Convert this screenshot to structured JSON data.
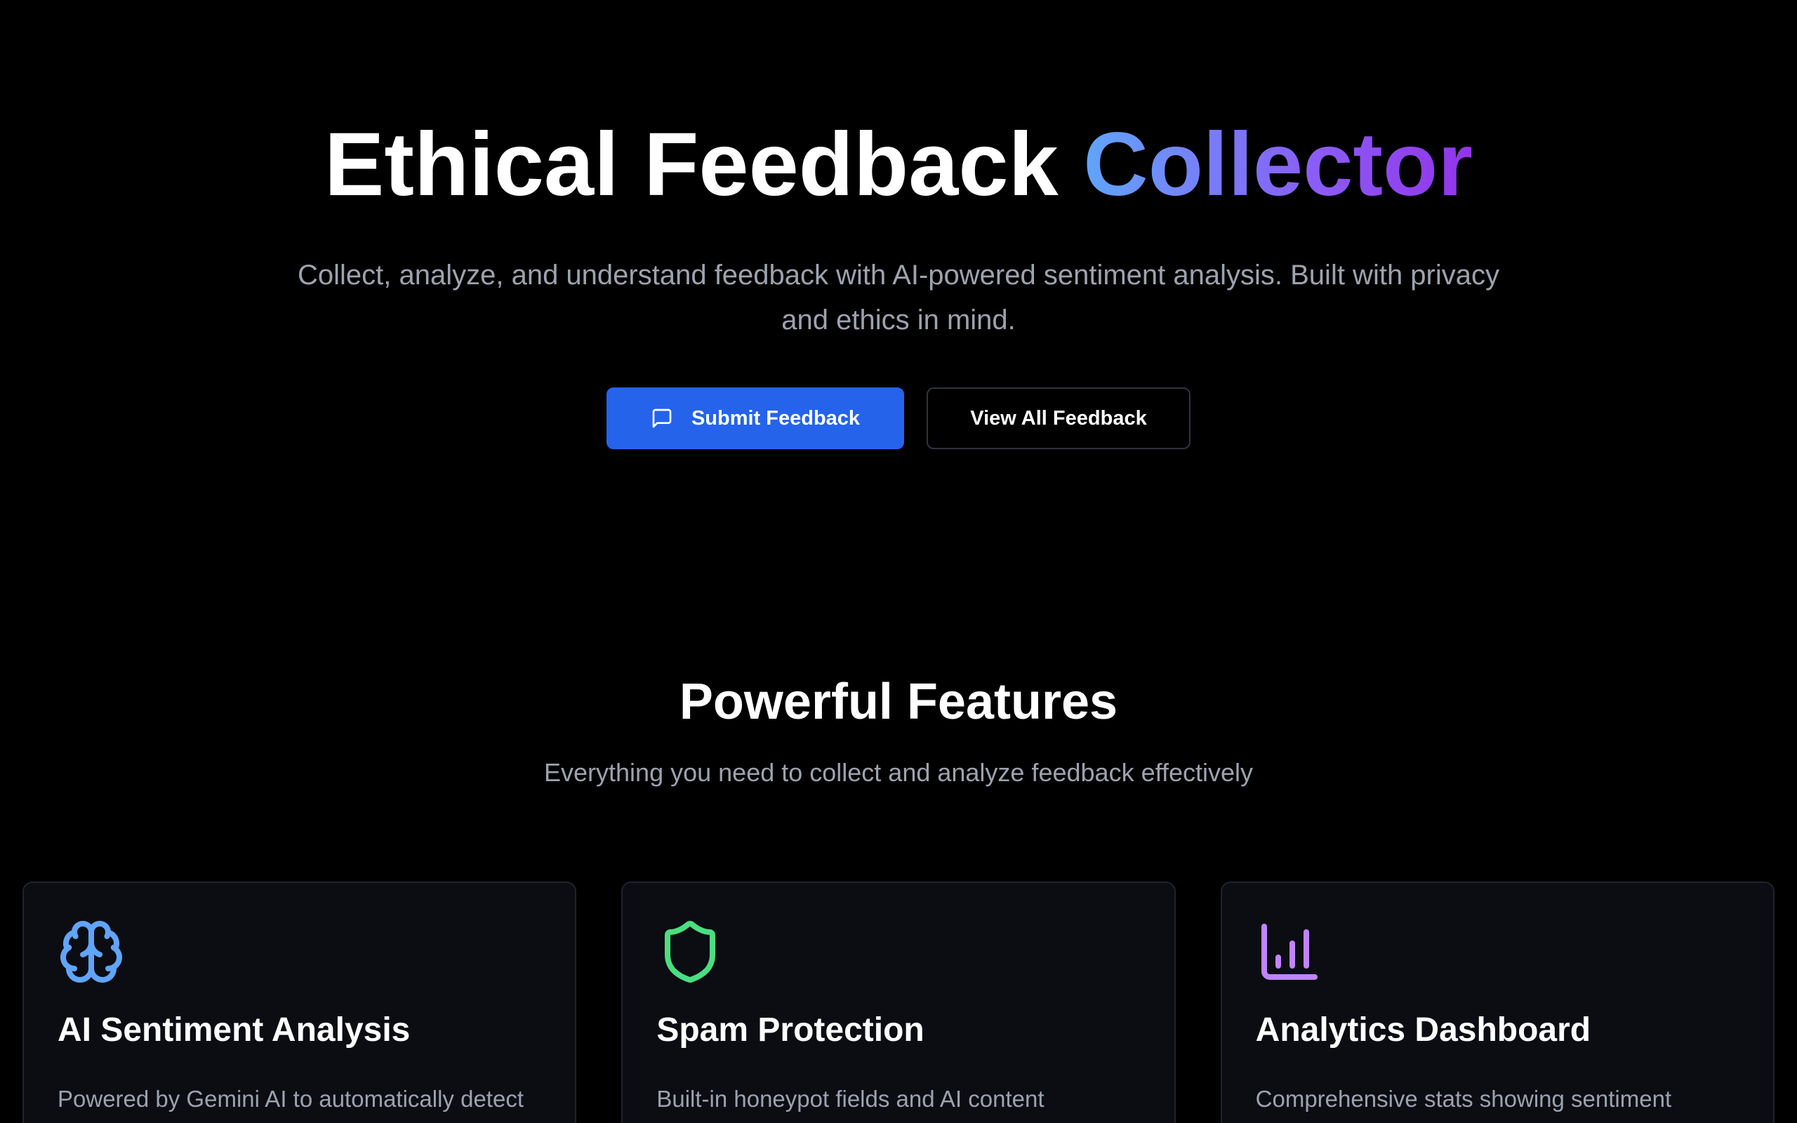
{
  "hero": {
    "title_main": "Ethical Feedback ",
    "title_accent": "Collector",
    "subtitle": "Collect, analyze, and understand feedback with AI-powered sentiment analysis. Built with privacy and ethics in mind.",
    "primary_button": {
      "label": "Submit Feedback",
      "icon": "message-square-icon"
    },
    "secondary_button": {
      "label": "View All Feedback"
    }
  },
  "features": {
    "title": "Powerful Features",
    "subtitle": "Everything you need to collect and analyze feedback effectively",
    "cards": [
      {
        "icon": "brain-icon",
        "icon_color": "#60a5fa",
        "title": "AI Sentiment Analysis",
        "description": "Powered by Gemini AI to automatically detect"
      },
      {
        "icon": "shield-icon",
        "icon_color": "#4ade80",
        "title": "Spam Protection",
        "description": "Built-in honeypot fields and AI content"
      },
      {
        "icon": "bar-chart-icon",
        "icon_color": "#c084fc",
        "title": "Analytics Dashboard",
        "description": "Comprehensive stats showing sentiment"
      }
    ]
  },
  "colors": {
    "background": "#000000",
    "primary": "#2563eb",
    "muted_text": "#9ca3af",
    "card_background": "#0b0d13"
  }
}
